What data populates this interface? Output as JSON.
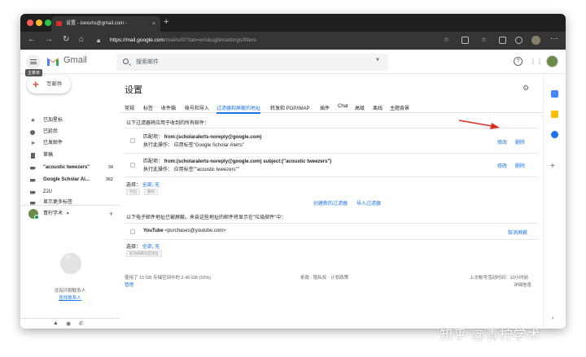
{
  "browser": {
    "tab_title": "设置 - isexuhs@gmail.com -",
    "tab_close": "×",
    "new_tab": "+",
    "url_host": "https://mail.google.com",
    "url_path": "/mail/u/0/?tab=wm&ogbl#settings/filters"
  },
  "header": {
    "app_name": "Gmail",
    "search_placeholder": "搜索邮件",
    "tooltip": "主菜单"
  },
  "sidebar": {
    "compose_label": "写邮件",
    "items": [
      {
        "label": "已加星标",
        "icon": "star-icon",
        "count": ""
      },
      {
        "label": "已延后",
        "icon": "clock-icon",
        "count": ""
      },
      {
        "label": "已发邮件",
        "icon": "send-icon",
        "count": ""
      },
      {
        "label": "草稿",
        "icon": "draft-icon",
        "count": ""
      },
      {
        "label": "\"acoustic tweezers\"",
        "icon": "label-icon",
        "count": "34"
      },
      {
        "label": "Google Scholar Al...",
        "icon": "label-icon",
        "count": "362"
      },
      {
        "label": "ZJU",
        "icon": "label-icon",
        "count": ""
      },
      {
        "label": "显示更多标签",
        "icon": "label-icon",
        "count": ""
      }
    ],
    "hangouts_user": "青柠学术",
    "hangouts_caret": "▾",
    "no_chats": "没有环聊联系人",
    "find_contact": "查找联系人"
  },
  "settings": {
    "title": "设置",
    "tabs": [
      "常规",
      "标签",
      "收件箱",
      "帐号和导入",
      "过滤器和屏蔽的地址",
      "转发和 POP/IMAP",
      "插件",
      "Chat",
      "高级",
      "离线",
      "主题背景"
    ],
    "active_tab": "过滤器和屏蔽的地址",
    "filters_heading": "以下过滤器将应用于收到的所有邮件：",
    "filters": [
      {
        "match_label": "匹配项：",
        "match_value": "from:(scholaralerts-noreply@google.com)",
        "action_label": "执行此操作：",
        "action_value": "应用标签\"Google Scholar Alerts\"",
        "edit": "修改",
        "delete": "删除"
      },
      {
        "match_label": "匹配项：",
        "match_value": "from:(scholaralerts-noreply@google.com) subject:(\"acoustic tweezers\")",
        "action_label": "执行此操作：",
        "action_value": "应用标签\"\"acoustic tweezers\"\"",
        "edit": "修改",
        "delete": "删除"
      }
    ],
    "select_label": "选择：",
    "select_all": "全部",
    "select_sep": ",",
    "select_none": "无",
    "export_btn": "导出",
    "delete_btn": "删除",
    "create_filter": "创建新的过滤器",
    "import_filter": "导入过滤器",
    "blocked_heading": "以下电子邮件地址已被屏蔽。来自这些地址的邮件将显示在\"垃圾邮件\"中：",
    "blocked": [
      {
        "name": "YouTube",
        "email": "<purchases@youtube.com>",
        "action": "取消屏蔽"
      }
    ],
    "unblock_selected": "取消屏蔽选定地址"
  },
  "footer": {
    "storage": "使用了 15 GB 存储空间中的 2.46 GB (16%)",
    "manage": "管理",
    "terms": "条款 · 隐私权 · 计划政策",
    "last_activity": "上次帐号活动时间：10小时前",
    "details": "详细信息"
  },
  "watermark": "知乎 @青柠学术",
  "colors": {
    "accent": "#1a73e8",
    "arrow": "#d93025",
    "browser_chrome": "#353535"
  }
}
